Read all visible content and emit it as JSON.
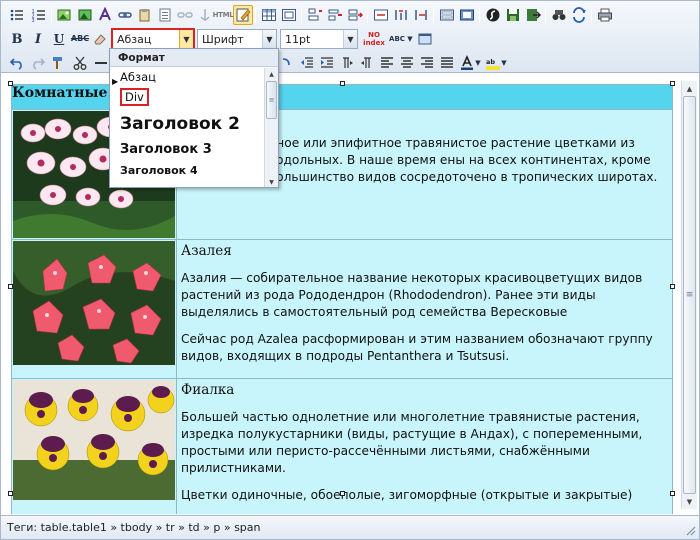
{
  "toolbar": {
    "row1_icons": [
      "bullet-list-icon",
      "numbered-list-icon",
      "insert-image-icon",
      "insert-image-map-icon",
      "insert-flash-icon",
      "insert-link-icon",
      "paste-icon",
      "paste-text-icon",
      "unlink-icon",
      "insert-anchor-icon",
      "html-source-icon",
      "edit-mode-icon",
      "table-icon",
      "table-properties-icon",
      "insert-row-icon",
      "delete-row-icon",
      "insert-column-icon",
      "merge-cells-icon",
      "split-cells-icon",
      "hr-icon",
      "form-icon",
      "layers-icon",
      "flash-icon",
      "save-icon",
      "export-icon",
      "find-icon",
      "replace-icon",
      "print-icon"
    ],
    "html_label": "HTML",
    "bold_label": "B",
    "italic_label": "I",
    "underline_label": "U",
    "strike_label": "ABC",
    "format_select_value": "Абзац",
    "font_select_value": "Шрифт",
    "size_select_value": "11pt",
    "spellcheck_label": "NO index",
    "abc_label": "ABC"
  },
  "format_dropdown": {
    "header": "Формат",
    "items": [
      {
        "label": "Абзац",
        "selected": true
      },
      {
        "label": "Div",
        "highlighted": true
      },
      {
        "label": "Заголовок 2"
      },
      {
        "label": "Заголовок 3"
      },
      {
        "label": "Заголовок 4"
      }
    ]
  },
  "document": {
    "table_header": "Комнатные",
    "rows": [
      {
        "image_icon": "orchid-photo",
        "title": "",
        "paragraphs": [
          "олетнее наземное или эпифитное травянистое растение цветками из семейства однодольных. В наше время ены на всех континентах, кроме Антарктиды. Большинство видов сосредоточено в тропических широтах."
        ]
      },
      {
        "image_icon": "azalea-photo",
        "title": "Азалея",
        "paragraphs": [
          "Азалия  — собирательное название некоторых красивоцветущих видов растений из рода Рододендрон (Rhododendron). Ранее эти виды выделялись в самостоятельный род семейства Вересковые",
          "Сейчас род Azalea расформирован и этим названием обозначают группу видов, входящих в подроды Pentanthera и Tsutsusi."
        ]
      },
      {
        "image_icon": "pansy-photo",
        "title": "Фиалка",
        "paragraphs": [
          "Большей частью однолетние или многолетние травянистые растения, изредка полукустарники (виды, растущие в Андах), с попеременными, простыми или перисто-рассечёнными листьями, снабжёнными прилистниками.",
          "Цветки одиночные, обоеполые, зигоморфные (открытые и закрытые)"
        ]
      }
    ]
  },
  "statusbar": {
    "path": "Теги: table.table1 » tbody » tr » td » p » span"
  },
  "colors": {
    "table_background": "#c8f5fb",
    "header_background": "#55d4ee",
    "highlight_border": "#d82323"
  }
}
